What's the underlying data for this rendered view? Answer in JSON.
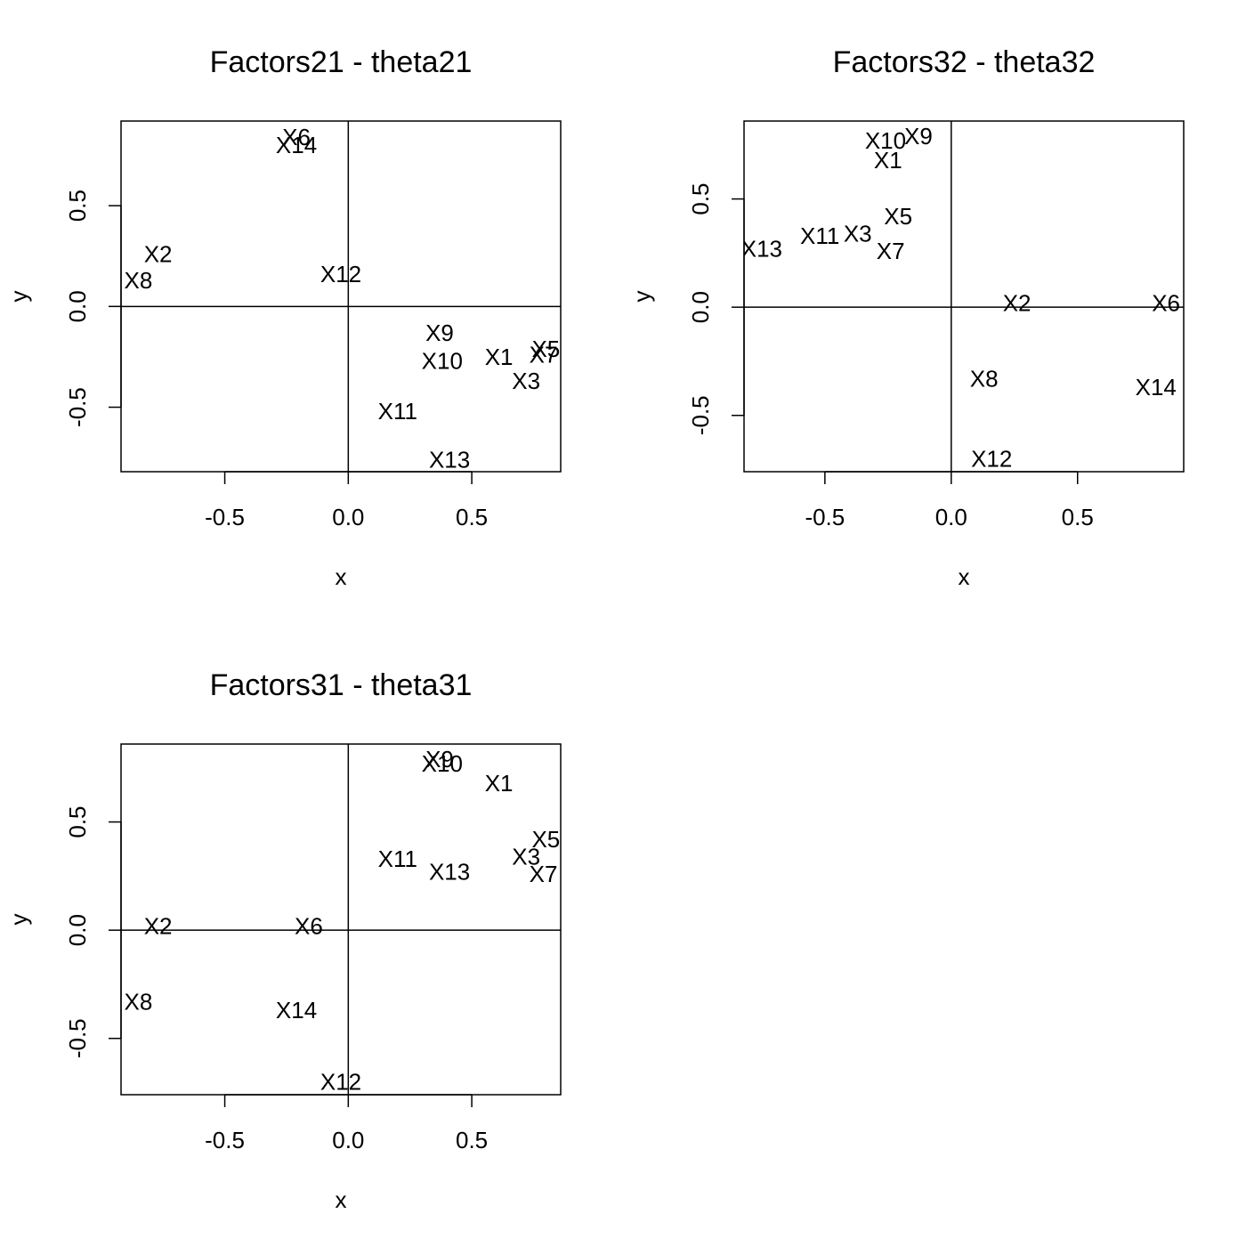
{
  "chart_data": [
    {
      "type": "scatter",
      "title": "Factors21 - theta21",
      "xlabel": "x",
      "ylabel": "y",
      "xlim": [
        -0.92,
        0.86
      ],
      "ylim": [
        -0.82,
        0.92
      ],
      "xticks": [
        {
          "value": -0.5,
          "label": "-0.5"
        },
        {
          "value": 0.0,
          "label": "0.0"
        },
        {
          "value": 0.5,
          "label": "0.5"
        }
      ],
      "yticks": [
        {
          "value": -0.5,
          "label": "-0.5"
        },
        {
          "value": 0.0,
          "label": "0.0"
        },
        {
          "value": 0.5,
          "label": "0.5"
        }
      ],
      "reference_lines": {
        "x": 0,
        "y": 0
      },
      "points": [
        {
          "label": "X6",
          "x": -0.21,
          "y": 0.84
        },
        {
          "label": "X14",
          "x": -0.21,
          "y": 0.8
        },
        {
          "label": "X2",
          "x": -0.77,
          "y": 0.26
        },
        {
          "label": "X8",
          "x": -0.85,
          "y": 0.13
        },
        {
          "label": "X12",
          "x": -0.03,
          "y": 0.16
        },
        {
          "label": "X9",
          "x": 0.37,
          "y": -0.13
        },
        {
          "label": "X10",
          "x": 0.38,
          "y": -0.27
        },
        {
          "label": "X1",
          "x": 0.61,
          "y": -0.25
        },
        {
          "label": "X5",
          "x": 0.8,
          "y": -0.21
        },
        {
          "label": "X7",
          "x": 0.79,
          "y": -0.24
        },
        {
          "label": "X3",
          "x": 0.72,
          "y": -0.37
        },
        {
          "label": "X11",
          "x": 0.2,
          "y": -0.52
        },
        {
          "label": "X13",
          "x": 0.41,
          "y": -0.76
        }
      ]
    },
    {
      "type": "scatter",
      "title": "Factors32 - theta32",
      "xlabel": "x",
      "ylabel": "y",
      "xlim": [
        -0.82,
        0.92
      ],
      "ylim": [
        -0.76,
        0.86
      ],
      "xticks": [
        {
          "value": -0.5,
          "label": "-0.5"
        },
        {
          "value": 0.0,
          "label": "0.0"
        },
        {
          "value": 0.5,
          "label": "0.5"
        }
      ],
      "yticks": [
        {
          "value": -0.5,
          "label": "-0.5"
        },
        {
          "value": 0.0,
          "label": "0.0"
        },
        {
          "value": 0.5,
          "label": "0.5"
        }
      ],
      "reference_lines": {
        "x": 0,
        "y": 0
      },
      "points": [
        {
          "label": "X10",
          "x": -0.26,
          "y": 0.77
        },
        {
          "label": "X9",
          "x": -0.13,
          "y": 0.79
        },
        {
          "label": "X1",
          "x": -0.25,
          "y": 0.68
        },
        {
          "label": "X5",
          "x": -0.21,
          "y": 0.42
        },
        {
          "label": "X11",
          "x": -0.52,
          "y": 0.33
        },
        {
          "label": "X3",
          "x": -0.37,
          "y": 0.34
        },
        {
          "label": "X7",
          "x": -0.24,
          "y": 0.26
        },
        {
          "label": "X13",
          "x": -0.75,
          "y": 0.27
        },
        {
          "label": "X2",
          "x": 0.26,
          "y": 0.02
        },
        {
          "label": "X6",
          "x": 0.85,
          "y": 0.02
        },
        {
          "label": "X8",
          "x": 0.13,
          "y": -0.33
        },
        {
          "label": "X14",
          "x": 0.81,
          "y": -0.37
        },
        {
          "label": "X12",
          "x": 0.16,
          "y": -0.7
        }
      ]
    },
    {
      "type": "scatter",
      "title": "Factors31 - theta31",
      "xlabel": "x",
      "ylabel": "y",
      "xlim": [
        -0.92,
        0.86
      ],
      "ylim": [
        -0.76,
        0.86
      ],
      "xticks": [
        {
          "value": -0.5,
          "label": "-0.5"
        },
        {
          "value": 0.0,
          "label": "0.0"
        },
        {
          "value": 0.5,
          "label": "0.5"
        }
      ],
      "yticks": [
        {
          "value": -0.5,
          "label": "-0.5"
        },
        {
          "value": 0.0,
          "label": "0.0"
        },
        {
          "value": 0.5,
          "label": "0.5"
        }
      ],
      "reference_lines": {
        "x": 0,
        "y": 0
      },
      "points": [
        {
          "label": "X9",
          "x": 0.37,
          "y": 0.79
        },
        {
          "label": "X10",
          "x": 0.38,
          "y": 0.77
        },
        {
          "label": "X1",
          "x": 0.61,
          "y": 0.68
        },
        {
          "label": "X5",
          "x": 0.8,
          "y": 0.42
        },
        {
          "label": "X3",
          "x": 0.72,
          "y": 0.34
        },
        {
          "label": "X7",
          "x": 0.79,
          "y": 0.26
        },
        {
          "label": "X11",
          "x": 0.2,
          "y": 0.33
        },
        {
          "label": "X13",
          "x": 0.41,
          "y": 0.27
        },
        {
          "label": "X2",
          "x": -0.77,
          "y": 0.02
        },
        {
          "label": "X6",
          "x": -0.16,
          "y": 0.02
        },
        {
          "label": "X8",
          "x": -0.85,
          "y": -0.33
        },
        {
          "label": "X14",
          "x": -0.21,
          "y": -0.37
        },
        {
          "label": "X12",
          "x": -0.03,
          "y": -0.7
        }
      ]
    }
  ]
}
